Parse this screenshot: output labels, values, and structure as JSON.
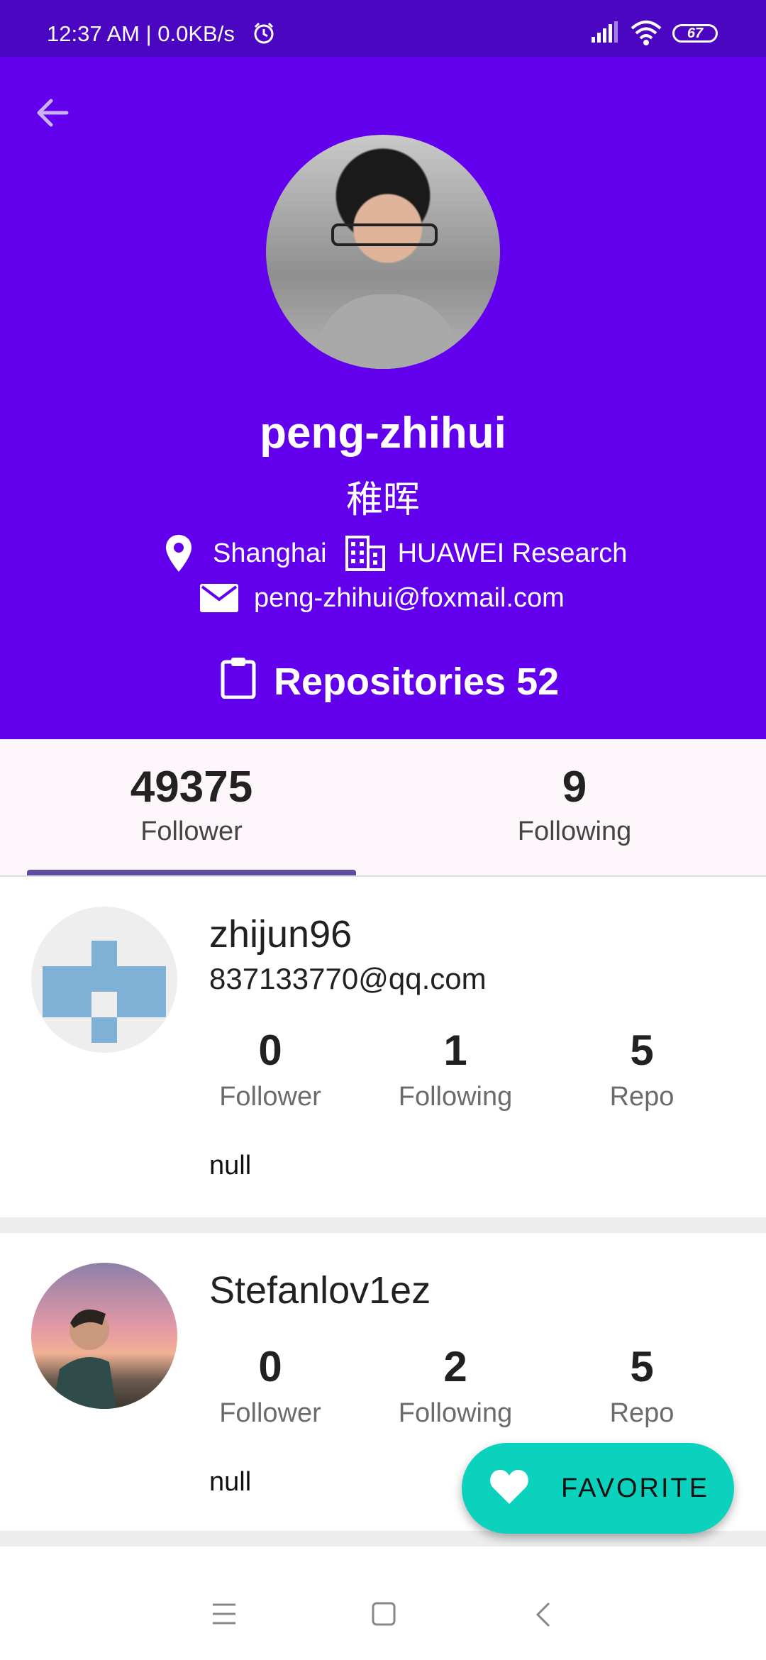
{
  "status_bar": {
    "time_speed": "12:37 AM | 0.0KB/s",
    "battery": "67"
  },
  "profile": {
    "username": "peng-zhihui",
    "nickname": "稚晖",
    "location": "Shanghai",
    "company": "HUAWEI Research",
    "email": "peng-zhihui@foxmail.com",
    "repositories": "Repositories 52"
  },
  "tabs": [
    {
      "count": "49375",
      "label": "Follower"
    },
    {
      "count": "9",
      "label": "Following"
    }
  ],
  "users": [
    {
      "login": "zhijun96",
      "email": "837133770@qq.com",
      "follower": "0",
      "follower_label": "Follower",
      "following": "1",
      "following_label": "Following",
      "repo": "5",
      "repo_label": "Repo",
      "bio": "null"
    },
    {
      "login": "Stefanlov1ez",
      "follower": "0",
      "follower_label": "Follower",
      "following": "2",
      "following_label": "Following",
      "repo": "5",
      "repo_label": "Repo",
      "bio": "null"
    }
  ],
  "fab": {
    "label": "FAVORITE"
  },
  "colors": {
    "primary": "#6200ee",
    "status_bar": "#4b06c2",
    "tab_indicator": "#5c4da3",
    "fab": "#0bd2bd"
  }
}
